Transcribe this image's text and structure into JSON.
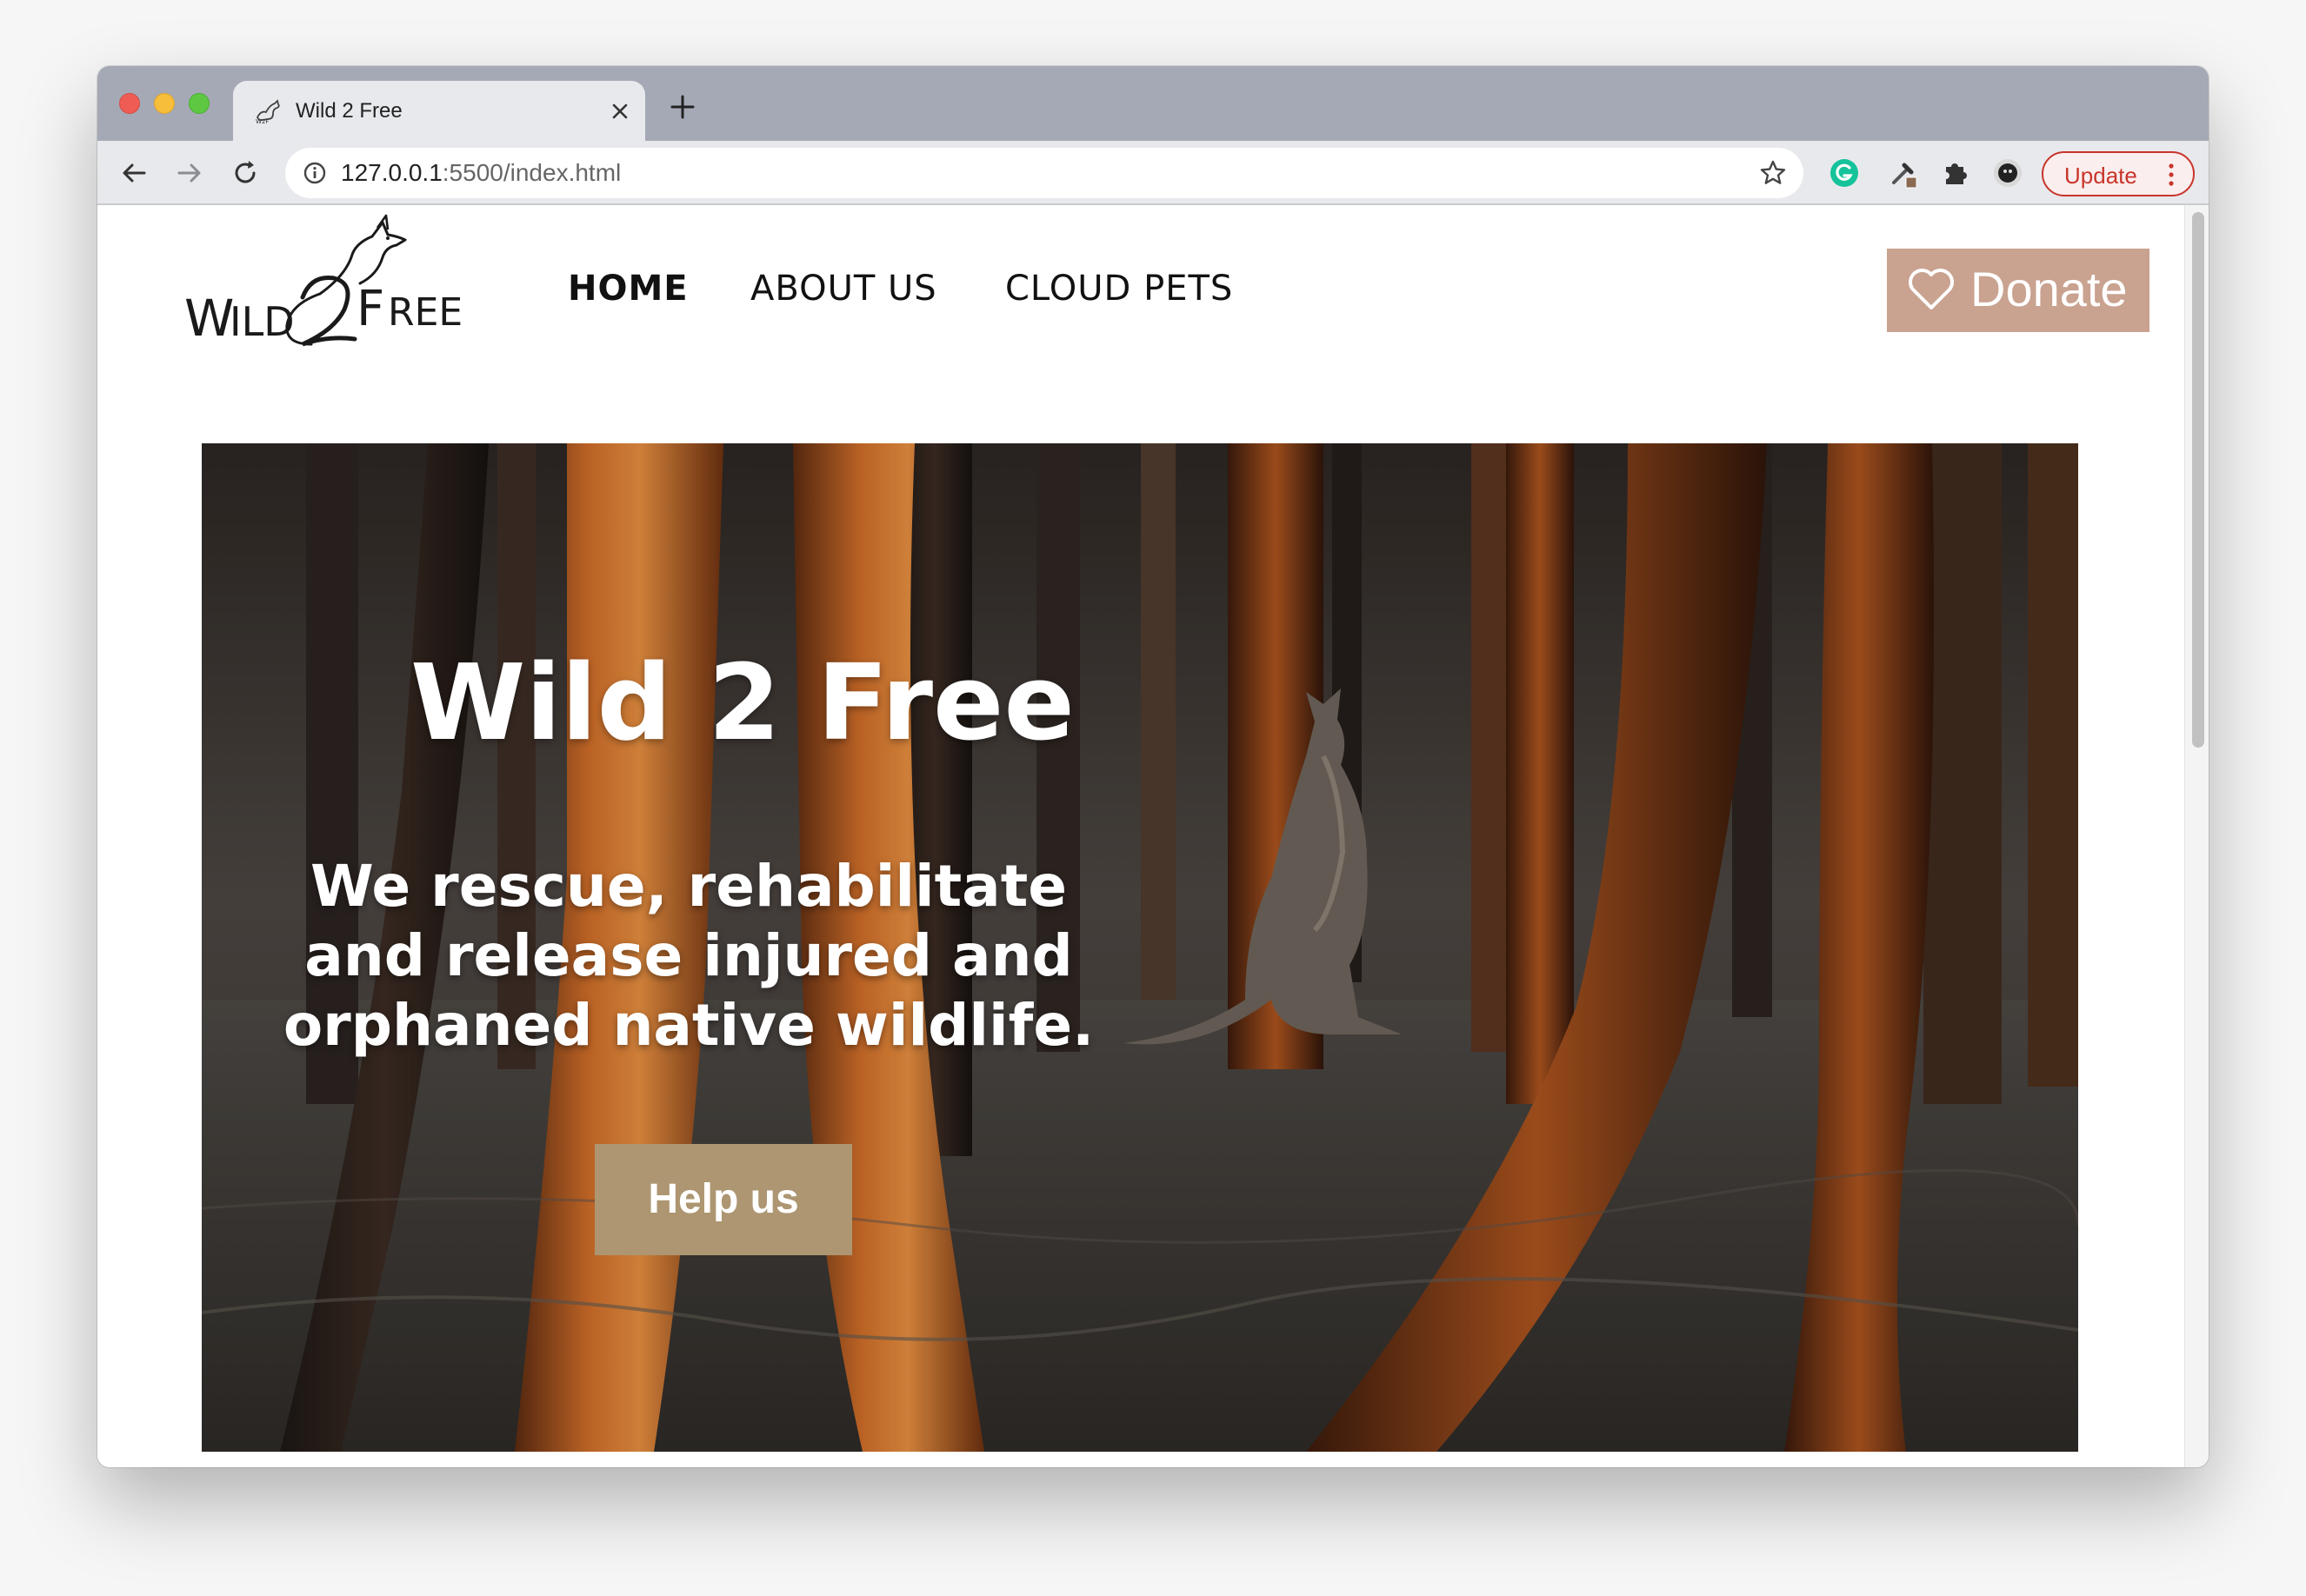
{
  "browser": {
    "tab_title": "Wild 2 Free",
    "url_host": "127.0.0.1",
    "url_path": ":5500/index.html",
    "update_label": "Update"
  },
  "site": {
    "logo_text": "WILD 2 FREE",
    "nav": {
      "home": "HOME",
      "about": "ABOUT US",
      "cloud_pets": "CLOUD PETS"
    },
    "donate_label": "Donate"
  },
  "hero": {
    "title": "Wild 2 Free",
    "subtitle": "We rescue, rehabilitate and release injured and orphaned native wildlife.",
    "cta_label": "Help us"
  },
  "colors": {
    "donate_bg": "#c9a290",
    "cta_bg": "#ad9671",
    "update_red": "#c8352a",
    "tabstrip": "#a5a9b5"
  },
  "icons": [
    "back-arrow-icon",
    "forward-arrow-icon",
    "reload-icon",
    "info-icon",
    "star-icon",
    "grammarly-icon",
    "color-picker-icon",
    "puzzle-icon",
    "profile-avatar-icon",
    "kebab-menu-icon",
    "heart-icon",
    "close-icon",
    "plus-icon"
  ]
}
